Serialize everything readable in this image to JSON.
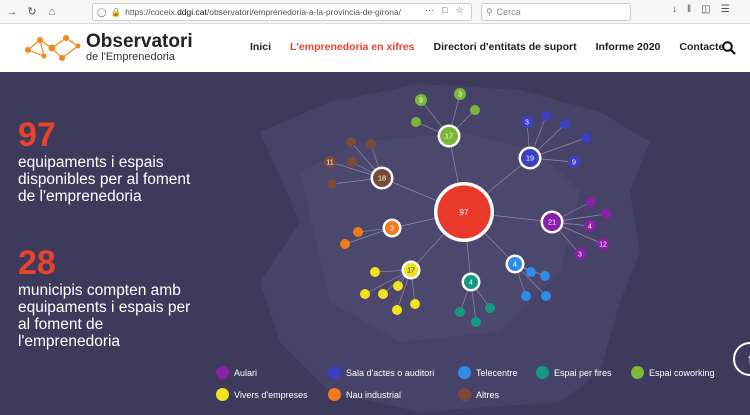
{
  "browser": {
    "url_prefix": "https://coceix.",
    "url_domain": "ddgi.cat",
    "url_path": "/observatori/emprenedoria-a-la-provincia-de-girona/",
    "search_placeholder": "Cerca",
    "menu_dots": "···"
  },
  "header": {
    "logo_title": "Observatori",
    "logo_subtitle": "de l'Emprenedoria",
    "menu": [
      "Inici",
      "L'emprenedoria en xifres",
      "Directori d'entitats de suport",
      "Informe 2020",
      "Contacte"
    ],
    "active_index": 1
  },
  "stats": {
    "first_number": "97",
    "first_text": "equipaments i espais disponibles per al foment de l'emprenedoria",
    "second_number": "28",
    "second_text": "municipis compten amb equipaments i espais per al foment de l'emprenedoria"
  },
  "network": {
    "center_label": "97",
    "center_color": "#e8392a",
    "hubs": [
      {
        "label": "17",
        "color": "#7ab83a",
        "children": [
          "9",
          "3",
          "",
          ""
        ]
      },
      {
        "label": "18",
        "color": "#7a4a38",
        "children": [
          "11",
          "",
          "",
          "",
          ""
        ]
      },
      {
        "label": "19",
        "color": "#3a3fc4",
        "children": [
          "3",
          "9",
          "",
          "",
          ""
        ]
      },
      {
        "label": "21",
        "color": "#8a1fa8",
        "children": [
          "4",
          "12",
          "3",
          "",
          ""
        ]
      },
      {
        "label": "3",
        "color": "#f07b1c",
        "children": [
          "",
          ""
        ]
      },
      {
        "label": "17",
        "color": "#f2e11d",
        "children": [
          "",
          "",
          "",
          "",
          "",
          ""
        ]
      },
      {
        "label": "4",
        "color": "#159a82",
        "children": [
          "",
          "",
          ""
        ]
      },
      {
        "label": "4",
        "color": "#2f8de8",
        "children": [
          "",
          "",
          "",
          ""
        ]
      }
    ]
  },
  "legend": [
    {
      "label": "Aulari",
      "color": "#8a1fa8"
    },
    {
      "label": "Sala d'actes o auditori",
      "color": "#3a3fc4"
    },
    {
      "label": "Telecentre",
      "color": "#2f8de8"
    },
    {
      "label": "Espai per fires",
      "color": "#159a82"
    },
    {
      "label": "Espai coworking",
      "color": "#7ab83a"
    },
    {
      "label": "Vivers d'empreses",
      "color": "#f2e11d"
    },
    {
      "label": "Nau industrial",
      "color": "#f07b1c"
    },
    {
      "label": "Altres",
      "color": "#7a4a38"
    }
  ]
}
